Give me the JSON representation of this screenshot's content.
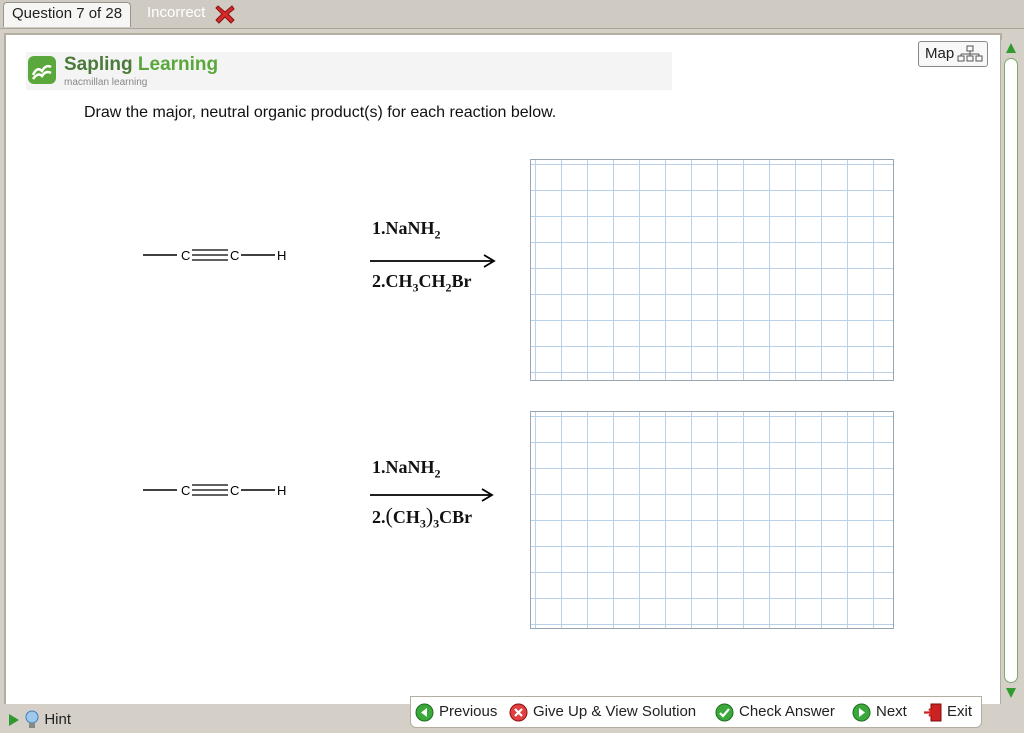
{
  "header": {
    "question_tab": "Question 7 of 28",
    "status": "Incorrect"
  },
  "brand": {
    "name_part1": "Sapling",
    "name_part2": "Learning",
    "subtitle": "macmillan learning"
  },
  "map_button": {
    "label": "Map"
  },
  "instruction": "Draw the major, neutral organic product(s) for each reaction below.",
  "reactions": [
    {
      "reactant_atoms": [
        "C",
        "C",
        "H"
      ],
      "step1": {
        "num": "1.",
        "reagent_main": "NaNH",
        "sub": "2"
      },
      "step2": {
        "num": "2.",
        "p1": "CH",
        "s1": "3",
        "p2": "CH",
        "s2": "2",
        "p3": "Br"
      }
    },
    {
      "reactant_atoms": [
        "C",
        "C",
        "H"
      ],
      "step1": {
        "num": "1.",
        "reagent_main": "NaNH",
        "sub": "2"
      },
      "step2": {
        "num": "2.",
        "open": "(",
        "p1": "CH",
        "s1": "3",
        "close": ")",
        "s2": "3",
        "p3": "CBr"
      }
    }
  ],
  "bottom_nav": {
    "previous": "Previous",
    "give_up": "Give Up & View Solution",
    "check": "Check Answer",
    "next": "Next",
    "exit": "Exit"
  },
  "hint": {
    "label": "Hint"
  },
  "colors": {
    "brand_green": "#5aa83b",
    "incorrect_red": "#d42a2a",
    "grid_line": "#b9d2ea",
    "scroll_green": "#2f9b2f"
  }
}
